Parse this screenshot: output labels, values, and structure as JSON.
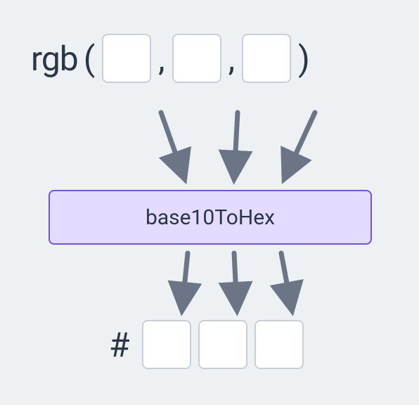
{
  "rgb": {
    "prefix": "rgb",
    "open": "(",
    "close": ")",
    "comma1": ",",
    "comma2": ","
  },
  "function": {
    "label": "base10ToHex"
  },
  "hex": {
    "hash": "#"
  }
}
